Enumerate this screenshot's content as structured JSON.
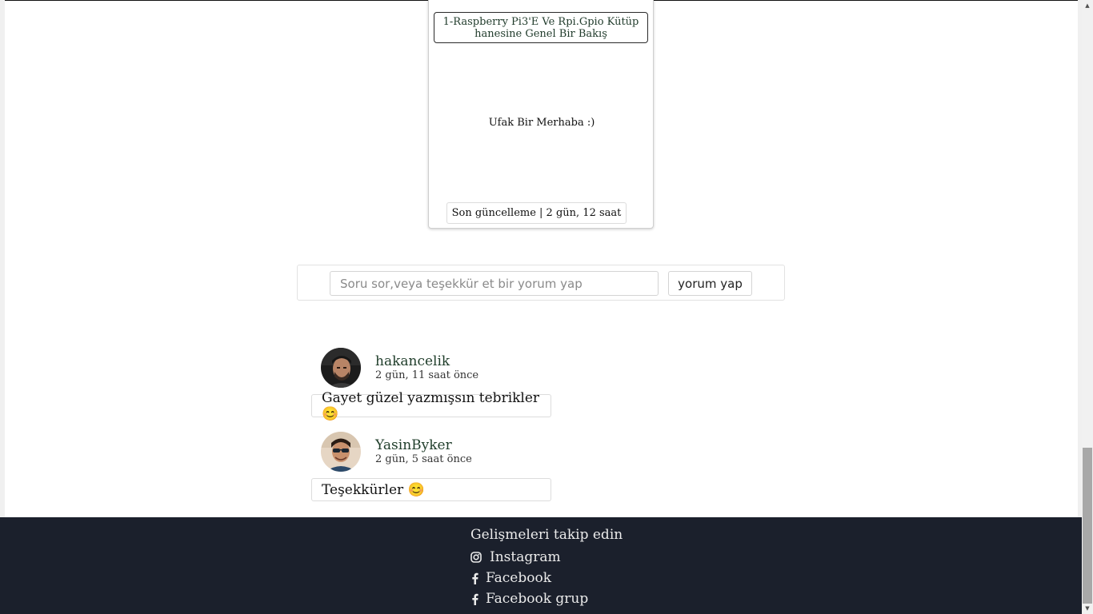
{
  "card": {
    "title": "1-Raspberry Pi3'E Ve Rpi.Gpio Kütüphanesine Genel Bir Bakış",
    "description": "Ufak Bir Merhaba :)",
    "updated": "Son güncelleme | 2 gün, 12 saat"
  },
  "comment_form": {
    "placeholder": "Soru sor,veya teşekkür et bir yorum yap",
    "submit_label": "yorum yap"
  },
  "comments": [
    {
      "user": "hakancelik",
      "time": "2 gün, 11 saat önce",
      "text": "Gayet güzel yazmışsın tebrikler 😊"
    },
    {
      "user": "YasinByker",
      "time": "2 gün, 5 saat önce",
      "text": "Teşekkürler 😊"
    }
  ],
  "footer": {
    "title": "Gelişmeleri takip edin",
    "links": [
      {
        "label": "Instagram",
        "icon": "instagram-icon"
      },
      {
        "label": "Facebook",
        "icon": "facebook-icon"
      },
      {
        "label": "Facebook grup",
        "icon": "facebook-icon"
      }
    ]
  },
  "colors": {
    "footer_bg": "#1b202c",
    "username": "#1f3d2a",
    "footer_text": "#ebebeb"
  }
}
